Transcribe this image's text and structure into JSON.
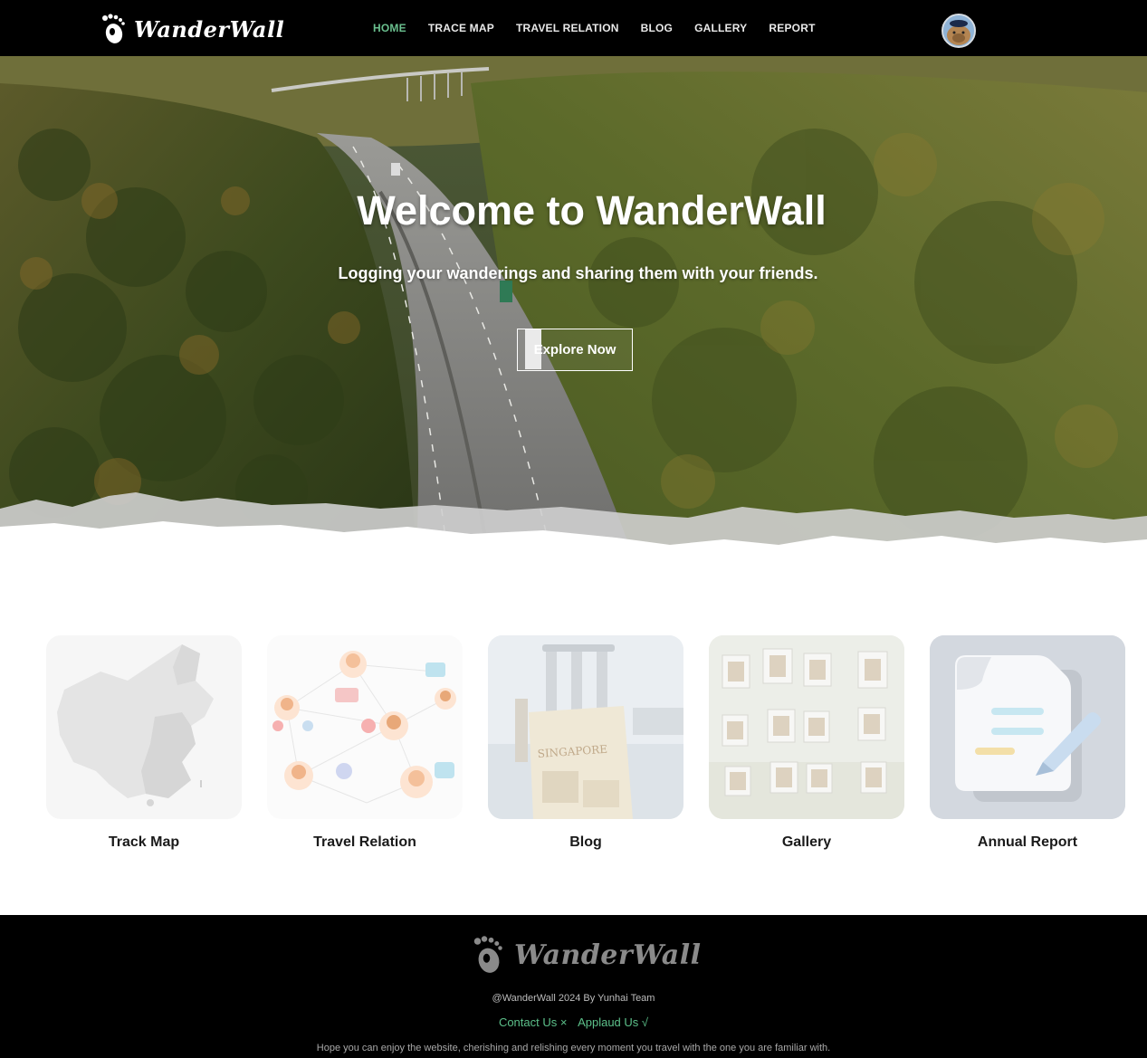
{
  "nav": {
    "brand": "WanderWall",
    "items": [
      {
        "label": "HOME",
        "active": true
      },
      {
        "label": "TRACE MAP",
        "active": false
      },
      {
        "label": "TRAVEL RELATION",
        "active": false
      },
      {
        "label": "BLOG",
        "active": false
      },
      {
        "label": "GALLERY",
        "active": false
      },
      {
        "label": "REPORT",
        "active": false
      }
    ],
    "active_color": "#6abf8e"
  },
  "hero": {
    "title": "Welcome to WanderWall",
    "subtitle": "Logging your wanderings and sharing them with your friends.",
    "cta": "Explore Now"
  },
  "cards": [
    {
      "label": "Track Map",
      "icon": "china-map-icon"
    },
    {
      "label": "Travel Relation",
      "icon": "network-icon"
    },
    {
      "label": "Blog",
      "icon": "blog-photo"
    },
    {
      "label": "Gallery",
      "icon": "gallery-photo"
    },
    {
      "label": "Annual Report",
      "icon": "report-document-icon"
    }
  ],
  "footer": {
    "brand": "WanderWall",
    "copyright": "@WanderWall 2024 By Yunhai Team",
    "contact": "Contact Us ×",
    "applaud": "Applaud Us √",
    "note": "Hope you can enjoy the website, cherishing and relishing every moment you travel with the one you are familiar with.",
    "link_color": "#5cc08a"
  }
}
